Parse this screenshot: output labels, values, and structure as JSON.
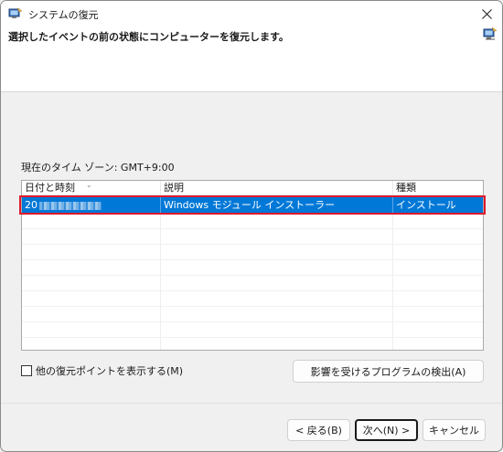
{
  "window": {
    "title": "システムの復元",
    "subtitle": "選択したイベントの前の状態にコンピューターを復元します。"
  },
  "timezone": {
    "label": "現在のタイム ゾーン: GMT+9:00"
  },
  "table": {
    "columns": [
      "日付と時刻",
      "説明",
      "種類"
    ],
    "rows": [
      {
        "date": "20",
        "description": "Windows モジュール インストーラー",
        "type": "インストール",
        "selected": true
      }
    ]
  },
  "options": {
    "show_more_label": "他の復元ポイントを表示する(M)",
    "show_more_checked": false,
    "detect_button": "影響を受けるプログラムの検出(A)"
  },
  "footer": {
    "back_label": "< 戻る(B)",
    "next_label": "次へ(N) >",
    "cancel_label": "キャンセル"
  },
  "colors": {
    "selection": "#0078d7",
    "highlight_border": "#e0192b"
  },
  "icons": {
    "title": "system-restore-icon",
    "header": "system-restore-icon",
    "close": "close-icon",
    "sort": "chevron-down-icon"
  }
}
